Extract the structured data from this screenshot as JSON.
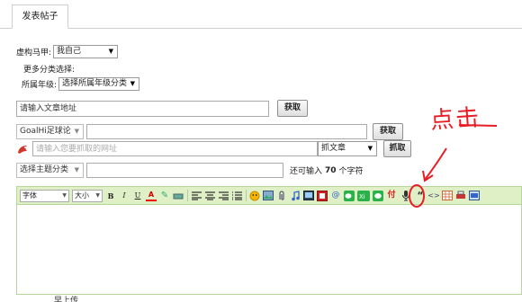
{
  "tab": {
    "label": "发表帖子"
  },
  "form": {
    "vest_label": "虚构马甲:",
    "vest_value": "我自己",
    "more_category_label": "更多分类选择:",
    "grade_label": "所属年级:",
    "grade_value": "选择所属年级分类",
    "url_value": "请输入文章地址",
    "fetch_button": "获取",
    "source_value": "GoalHi足球论",
    "get_button": "获取",
    "fetch_url_placeholder": "请输入您要抓取的网址",
    "grab_type_value": "抓文章",
    "grab_button": "抓取",
    "topic_value": "选择主题分类",
    "hint_prefix": "还可输入",
    "hint_count": "70",
    "hint_suffix": "个字符"
  },
  "toolbar": {
    "font_label": "字体",
    "size_label": "大小",
    "bold": "B",
    "italic": "I",
    "underline": "U",
    "pay": "付",
    "quote": "“",
    "code": "<>"
  },
  "annotation": {
    "text": "点击",
    "color": "#e81c24"
  },
  "bottom": {
    "label": "早上传"
  },
  "colors": {
    "toolbar_bg": "#dff0c7",
    "toolbar_border": "#b7d69a"
  }
}
